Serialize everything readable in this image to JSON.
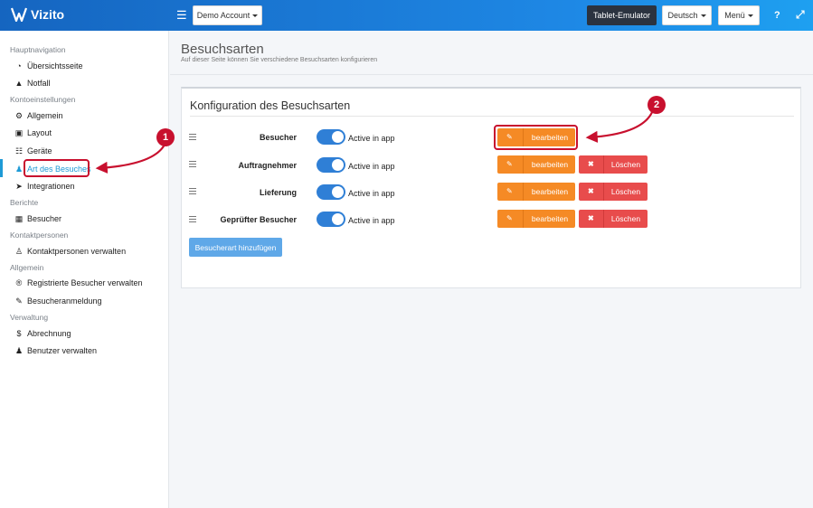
{
  "app": {
    "name": "Vizito"
  },
  "header": {
    "account_label": "Demo Account",
    "tablet_emulator_label": "Tablet-Emulator",
    "language_label": "Deutsch",
    "menu_label": "Menü",
    "help_icon": "question-icon",
    "expand_icon": "expand-icon"
  },
  "sidebar": {
    "sections": [
      {
        "title": "Hauptnavigation",
        "items": [
          {
            "label": "Übersichtsseite",
            "icon": "gauge-icon"
          },
          {
            "label": "Notfall",
            "icon": "warning-icon"
          }
        ]
      },
      {
        "title": "Kontoeinstellungen",
        "items": [
          {
            "label": "Allgemein",
            "icon": "gear-icon"
          },
          {
            "label": "Layout",
            "icon": "image-icon"
          },
          {
            "label": "Geräte",
            "icon": "sitemap-icon"
          },
          {
            "label": "Art des Besuches",
            "icon": "users-icon",
            "active": true
          },
          {
            "label": "Integrationen",
            "icon": "plug-icon"
          }
        ]
      },
      {
        "title": "Berichte",
        "items": [
          {
            "label": "Besucher",
            "icon": "book-icon"
          }
        ]
      },
      {
        "title": "Kontaktpersonen",
        "items": [
          {
            "label": "Kontaktpersonen verwalten",
            "icon": "user-icon"
          }
        ]
      },
      {
        "title": "Allgemein",
        "items": [
          {
            "label": "Registrierte Besucher verwalten",
            "icon": "registered-icon"
          },
          {
            "label": "Besucheranmeldung",
            "icon": "pencil-icon"
          }
        ]
      },
      {
        "title": "Verwaltung",
        "items": [
          {
            "label": "Abrechnung",
            "icon": "dollar-icon"
          },
          {
            "label": "Benutzer verwalten",
            "icon": "user-plus-icon"
          }
        ]
      }
    ]
  },
  "page": {
    "title": "Besuchsarten",
    "subtitle": "Auf dieser Seite können Sie verschiedene Besuchsarten konfigurieren"
  },
  "config": {
    "title": "Konfiguration des Besuchsarten",
    "toggle_label": "Active in app",
    "edit_label": "bearbeiten",
    "delete_label": "Löschen",
    "add_button_label": "Besucherart hinzufügen",
    "visit_types": [
      {
        "name": "Besucher",
        "active": true,
        "deletable": false
      },
      {
        "name": "Auftragnehmer",
        "active": true,
        "deletable": true
      },
      {
        "name": "Lieferung",
        "active": true,
        "deletable": true
      },
      {
        "name": "Geprüfter Besucher",
        "active": true,
        "deletable": true
      }
    ]
  },
  "annotations": [
    {
      "number": "1"
    },
    {
      "number": "2"
    }
  ],
  "colors": {
    "header_gradient_start": "#1565c0",
    "header_gradient_end": "#1ea0f0",
    "accent": "#1e9ad6",
    "edit_button": "#f58a25",
    "delete_button": "#e84c4c",
    "toggle_on": "#2f7fd6",
    "annotation": "#c8102e"
  }
}
